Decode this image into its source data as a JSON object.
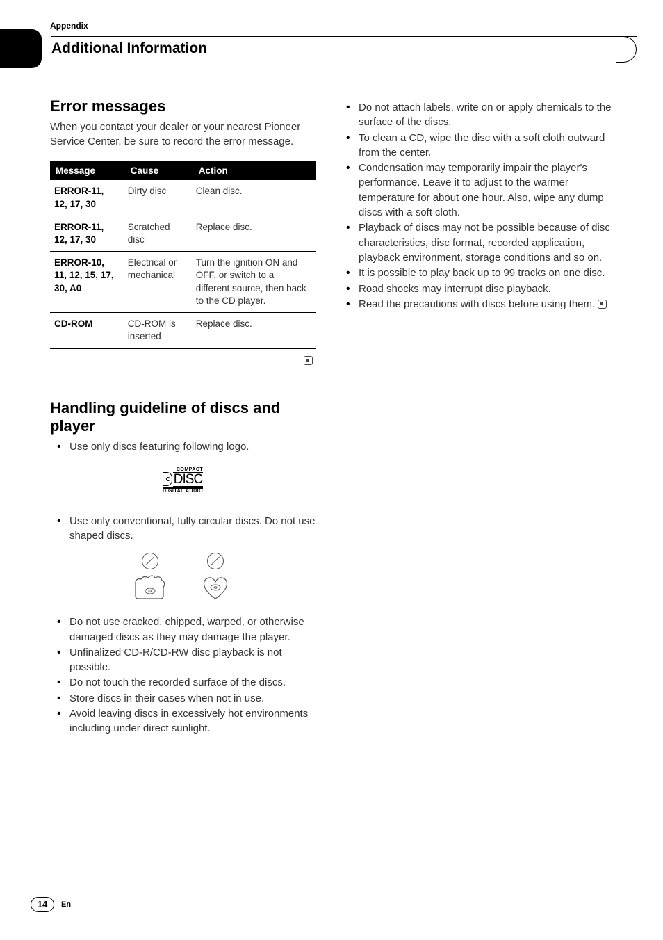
{
  "header": {
    "appendix": "Appendix",
    "section_title": "Additional Information"
  },
  "left": {
    "h_error": "Error messages",
    "intro": "When you contact your dealer or your nearest Pioneer Service Center, be sure to record the error message.",
    "table": {
      "headers": {
        "message": "Message",
        "cause": "Cause",
        "action": "Action"
      },
      "rows": [
        {
          "message": "ERROR-11, 12, 17, 30",
          "cause": "Dirty disc",
          "action": "Clean disc."
        },
        {
          "message": "ERROR-11, 12, 17, 30",
          "cause": "Scratched disc",
          "action": "Replace disc."
        },
        {
          "message": "ERROR-10, 11, 12, 15, 17, 30, A0",
          "cause": "Electrical or mechanical",
          "action": "Turn the ignition ON and OFF, or switch to a different source, then back to the CD player."
        },
        {
          "message": "CD-ROM",
          "cause": "CD-ROM is inserted",
          "action": "Replace disc."
        }
      ]
    },
    "h_handling": "Handling guideline of discs and player",
    "bullets1": [
      "Use only discs featuring following logo."
    ],
    "bullets2": [
      "Use only conventional, fully circular discs. Do not use shaped discs."
    ],
    "bullets3": [
      "Do not use cracked, chipped, warped, or otherwise damaged discs as they may damage the player.",
      "Unfinalized CD-R/CD-RW disc playback is not possible.",
      "Do not touch the recorded surface of the discs.",
      "Store discs in their cases when not in use.",
      "Avoid leaving discs in excessively hot environments including under direct sunlight."
    ]
  },
  "right": {
    "bullets": [
      "Do not attach labels, write on or apply chemicals to the surface of the discs.",
      "To clean a CD, wipe the disc with a soft cloth outward from the center.",
      "Condensation may temporarily impair the player's performance. Leave it to adjust to the warmer temperature for about one hour. Also, wipe any dump discs with a soft cloth.",
      "Playback of discs may not be possible because of disc characteristics, disc format, recorded application, playback environment, storage conditions and so on.",
      "It is possible to play back up to 99 tracks on one disc.",
      "Road shocks may interrupt disc playback.",
      "Read the precautions with discs before using them."
    ]
  },
  "logo": {
    "compact": "COMPACT",
    "letters": "DISC",
    "da": "DIGITAL AUDIO"
  },
  "footer": {
    "page": "14",
    "lang": "En"
  }
}
